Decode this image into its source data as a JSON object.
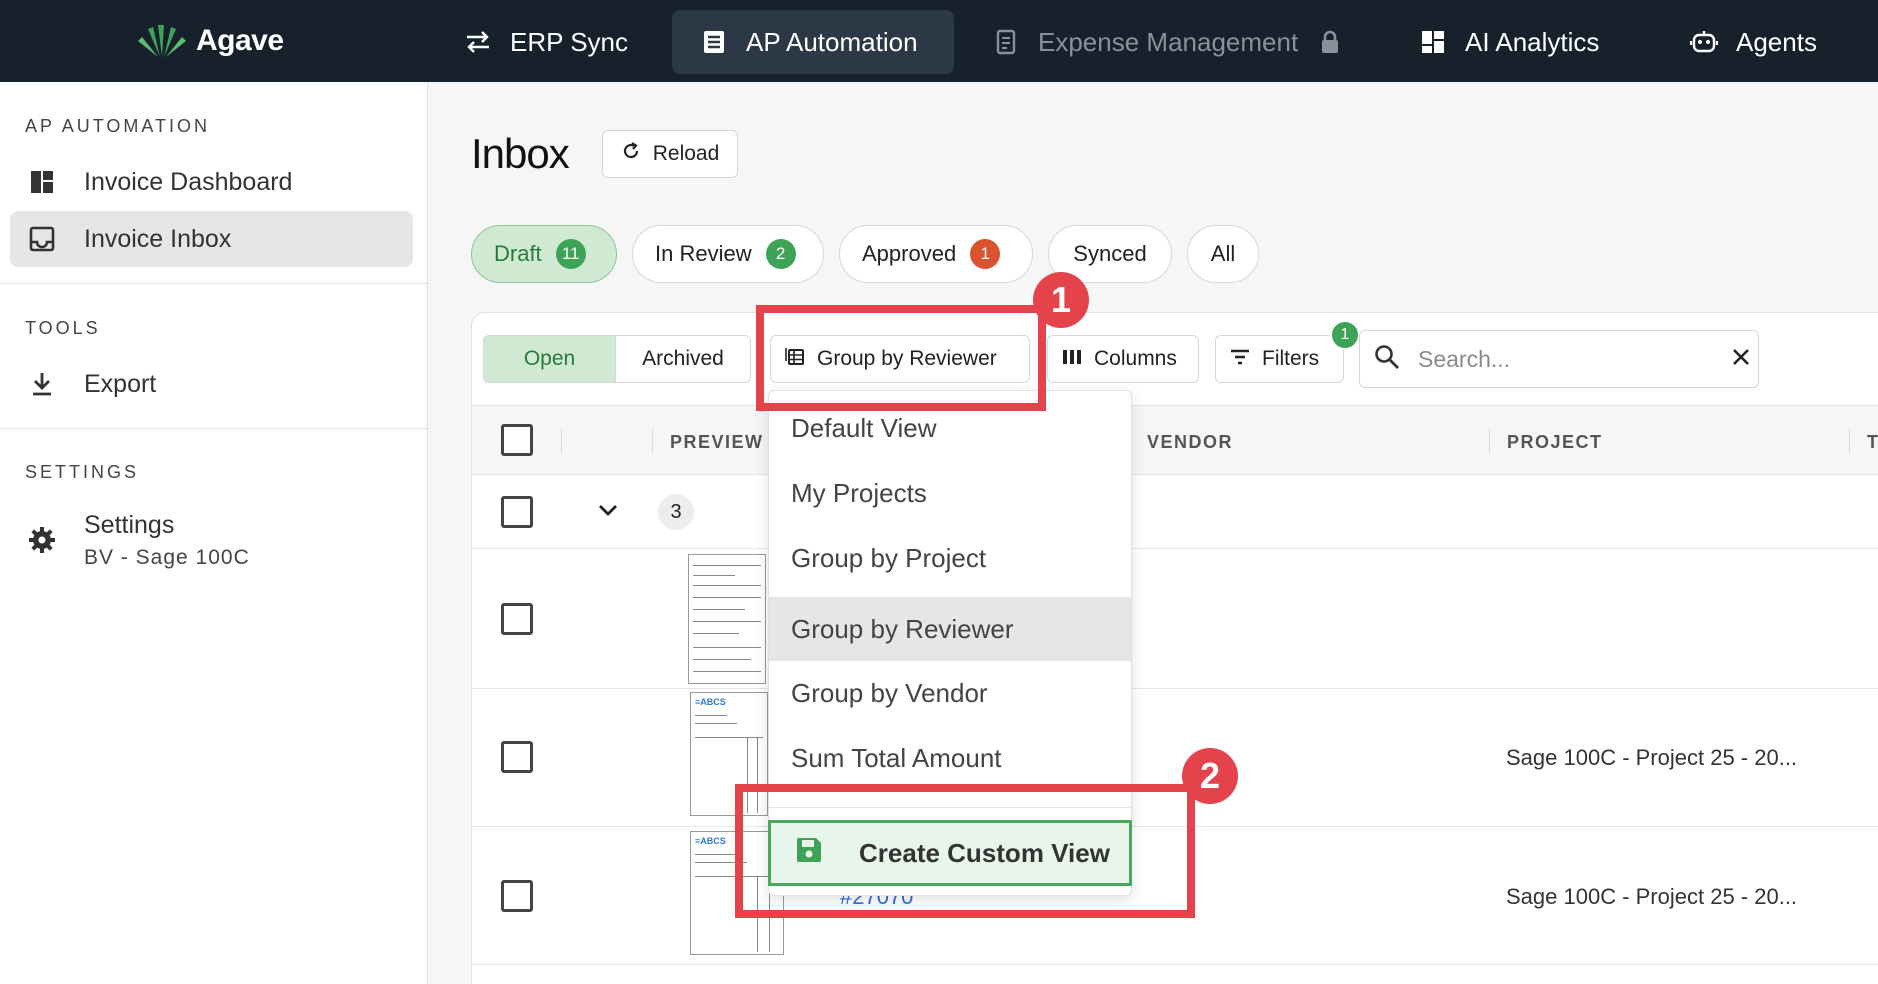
{
  "topnav": {
    "logo_text": "Agave",
    "items": [
      {
        "label": "ERP Sync",
        "icon": "arrows-swap-icon"
      },
      {
        "label": "AP Automation",
        "icon": "receipt-icon",
        "active": true
      },
      {
        "label": "Expense Management",
        "icon": "receipt-long-icon",
        "disabled": true,
        "locked": true
      },
      {
        "label": "AI Analytics",
        "icon": "dashboard-icon"
      },
      {
        "label": "Agents",
        "icon": "robot-icon"
      }
    ]
  },
  "sidebar": {
    "sections": [
      {
        "title": "AP AUTOMATION",
        "items": [
          {
            "label": "Invoice Dashboard",
            "icon": "dashboard-icon"
          },
          {
            "label": "Invoice Inbox",
            "icon": "inbox-icon",
            "active": true
          }
        ]
      },
      {
        "title": "TOOLS",
        "items": [
          {
            "label": "Export",
            "icon": "download-icon"
          }
        ]
      },
      {
        "title": "SETTINGS",
        "items": [
          {
            "label": "Settings",
            "sublabel": "BV - Sage 100C",
            "icon": "gear-icon"
          }
        ]
      }
    ]
  },
  "main": {
    "title": "Inbox",
    "reload_label": "Reload",
    "status_tabs": [
      {
        "label": "Draft",
        "count": "11",
        "active": true,
        "badge_color": "#3fa357"
      },
      {
        "label": "In Review",
        "count": "2",
        "badge_color": "#3fa357"
      },
      {
        "label": "Approved",
        "count": "1",
        "badge_color": "#d9532c"
      },
      {
        "label": "Synced"
      },
      {
        "label": "All"
      }
    ],
    "segment": {
      "open": "Open",
      "archived": "Archived",
      "selected": "Open"
    },
    "toolbar": {
      "group_by": "Group by Reviewer",
      "columns": "Columns",
      "filters": "Filters",
      "filters_count": "1"
    },
    "search": {
      "placeholder": "Search...",
      "value": ""
    },
    "table": {
      "columns": [
        "PREVIEW",
        "VENDOR",
        "PROJECT",
        "T"
      ],
      "group_count": "3",
      "rows": [
        {
          "project": ""
        },
        {
          "project": "Sage 100C - Project 25 - 20..."
        },
        {
          "project": "Sage 100C - Project 25 - 20...",
          "invoice_partial": "#27070"
        }
      ]
    },
    "view_menu": {
      "items": [
        "Default View",
        "My Projects",
        "Group by Project",
        "Group by Reviewer",
        "Group by Vendor",
        "Sum Total Amount"
      ],
      "selected": "Group by Reviewer",
      "create_label": "Create Custom View"
    }
  },
  "annotations": [
    {
      "number": "1",
      "target": "group-by-button"
    },
    {
      "number": "2",
      "target": "create-custom-view-button"
    }
  ],
  "colors": {
    "topbar": "#17212c",
    "accent_green": "#3fa357",
    "highlight_red": "#e5434c",
    "link_blue": "#2d6fd6"
  }
}
